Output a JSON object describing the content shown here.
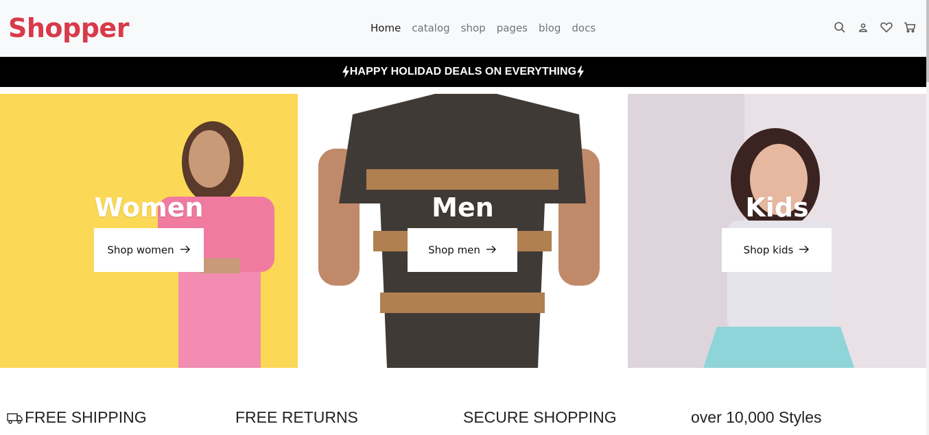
{
  "brand": {
    "name": "Shopper",
    "color": "#d83a4a"
  },
  "nav": {
    "items": [
      "Home",
      "catalog",
      "shop",
      "pages",
      "blog",
      "docs"
    ],
    "active": "Home"
  },
  "header_icons": [
    "search-icon",
    "user-icon",
    "heart-icon",
    "cart-icon"
  ],
  "announcement": {
    "text": "HAPPY HOLIDAD DEALS ON EVERYTHING"
  },
  "categories": [
    {
      "title": "Women",
      "button": "Shop women",
      "background": "#fbd957"
    },
    {
      "title": "Men",
      "button": "Shop men",
      "background": "#ffffff"
    },
    {
      "title": "Kids",
      "button": "Shop kids",
      "background": "#e9e1e6"
    }
  ],
  "features": [
    "FREE SHIPPING",
    "FREE RETURNS",
    "SECURE SHOPPING",
    "over 10,000 Styles"
  ]
}
